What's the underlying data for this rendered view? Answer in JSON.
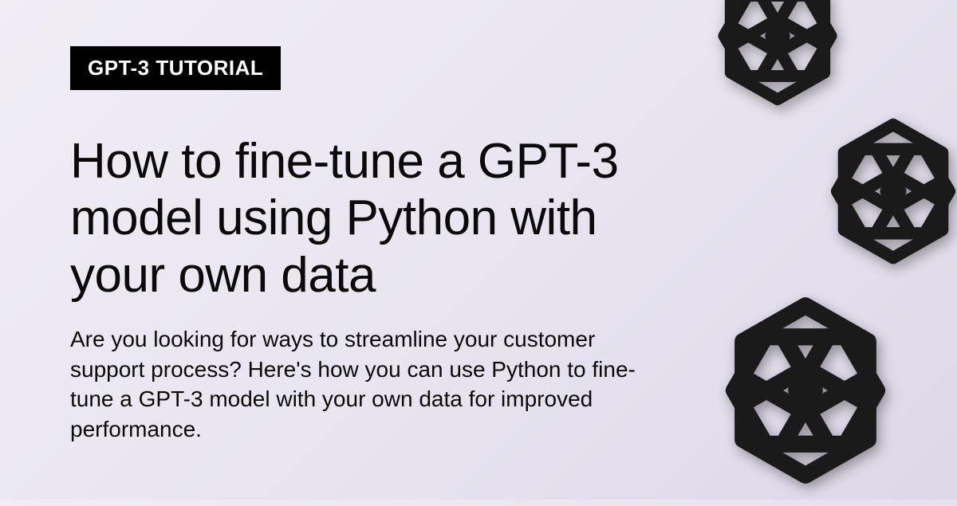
{
  "tag": "GPT-3 TUTORIAL",
  "title": "How to fine-tune a GPT-3 model using Python with your own data",
  "subtitle": "Are you looking for ways to streamline your customer support process? Here's how you can use Python to fine-tune a GPT-3 model with your own data for improved performance.",
  "icon": "openai-knot-icon"
}
